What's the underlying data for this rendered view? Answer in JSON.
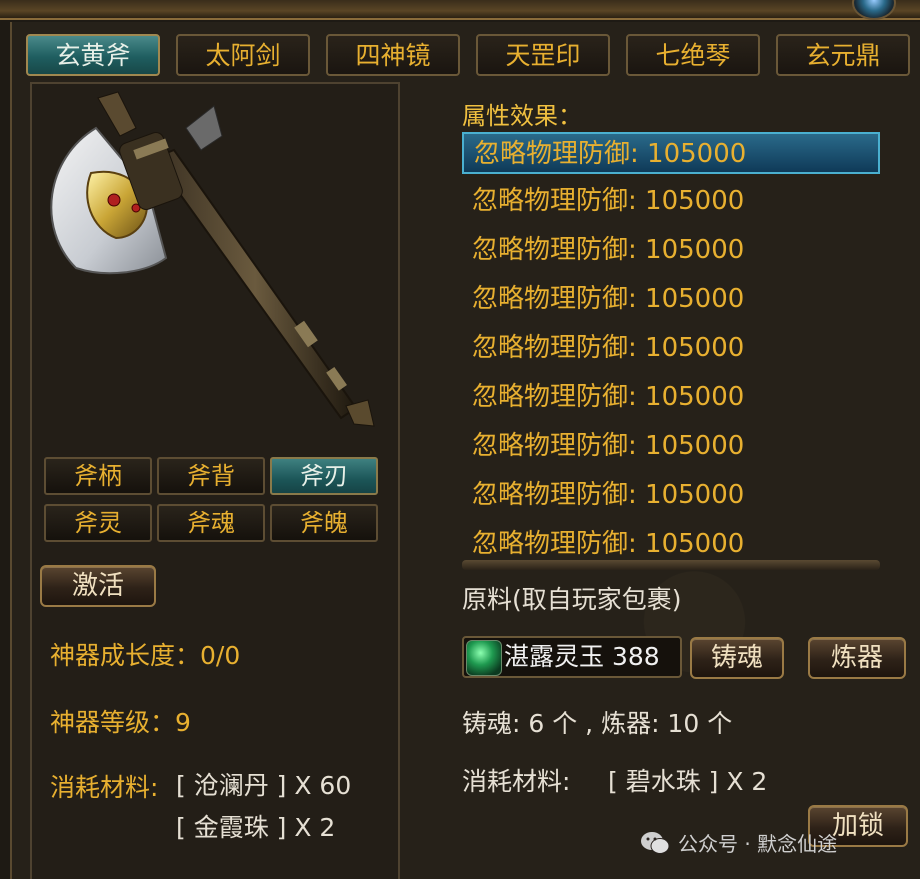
{
  "tabs": [
    {
      "label": "玄黄斧",
      "active": true
    },
    {
      "label": "太阿剑",
      "active": false
    },
    {
      "label": "四神镜",
      "active": false
    },
    {
      "label": "天罡印",
      "active": false
    },
    {
      "label": "七绝琴",
      "active": false
    },
    {
      "label": "玄元鼎",
      "active": false
    }
  ],
  "parts": [
    {
      "label": "斧柄",
      "active": false
    },
    {
      "label": "斧背",
      "active": false
    },
    {
      "label": "斧刃",
      "active": true
    },
    {
      "label": "斧灵",
      "active": false
    },
    {
      "label": "斧魂",
      "active": false
    },
    {
      "label": "斧魄",
      "active": false
    }
  ],
  "left": {
    "activate_label": "激活",
    "growth_label": "神器成长度：",
    "growth_value": "0/0",
    "level_label": "神器等级：",
    "level_value": "9",
    "consume_label": "消耗材料:",
    "consume_items": [
      "[ 沧澜丹 ] X 60",
      "[ 金霞珠 ] X 2"
    ]
  },
  "right": {
    "attr_title": "属性效果：",
    "attributes": [
      "忽略物理防御: 105000",
      "忽略物理防御: 105000",
      "忽略物理防御: 105000",
      "忽略物理防御: 105000",
      "忽略物理防御: 105000",
      "忽略物理防御: 105000",
      "忽略物理防御: 105000",
      "忽略物理防御: 105000",
      "忽略物理防御: 105000"
    ],
    "source_label": "原料(取自玩家包裹)",
    "material_name": "湛露灵玉 388",
    "cast_button": "铸魂",
    "refine_button": "炼器",
    "counts_text": "铸魂: 6 个 , 炼器: 10 个",
    "consume_label": "消耗材料:",
    "consume_item": "[ 碧水珠 ] X 2",
    "lock_button": "加锁"
  },
  "watermark": "公众号 · 默念仙途",
  "colors": {
    "gold": "#e8b030",
    "teal_active": "#1f5e60",
    "selected_row": "#0f3a58"
  }
}
